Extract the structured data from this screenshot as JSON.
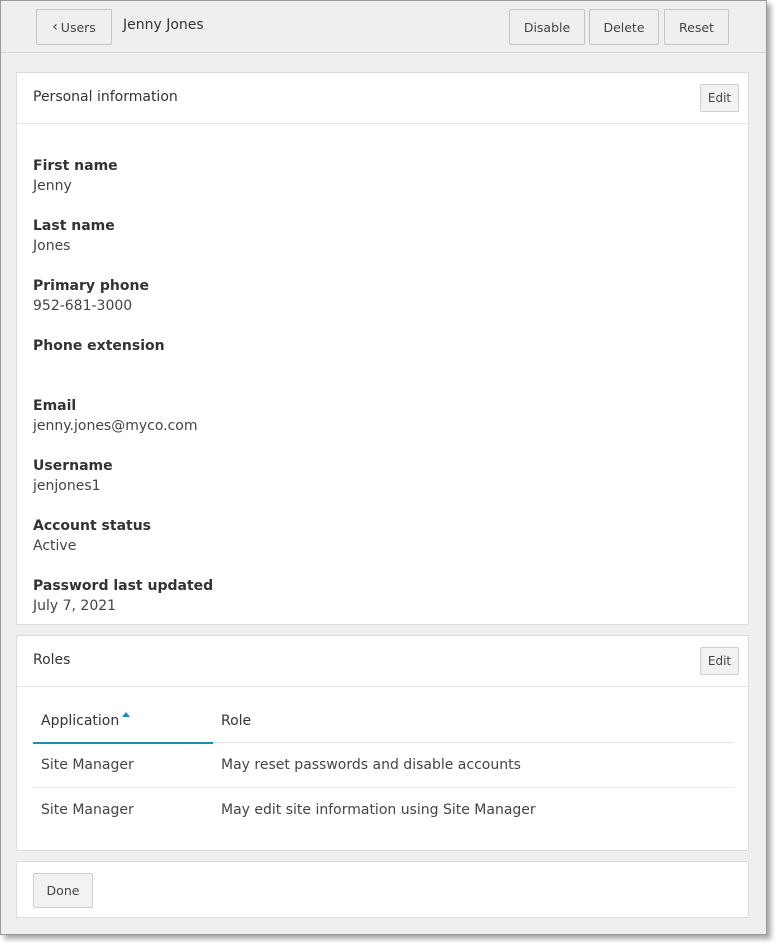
{
  "topbar": {
    "back_label": "Users",
    "title": "Jenny Jones",
    "disable_label": "Disable",
    "delete_label": "Delete",
    "reset_label": "Reset"
  },
  "personal": {
    "title": "Personal information",
    "edit_label": "Edit",
    "fields": [
      {
        "label": "First name",
        "value": "Jenny"
      },
      {
        "label": "Last name",
        "value": "Jones"
      },
      {
        "label": "Primary phone",
        "value": "952-681-3000"
      },
      {
        "label": "Phone extension",
        "value": ""
      },
      {
        "label": "Email",
        "value": "jenny.jones@myco.com"
      },
      {
        "label": "Username",
        "value": "jenjones1"
      },
      {
        "label": "Account status",
        "value": "Active"
      },
      {
        "label": "Password last updated",
        "value": "July 7, 2021"
      }
    ]
  },
  "roles": {
    "title": "Roles",
    "edit_label": "Edit",
    "columns": [
      "Application",
      "Role"
    ],
    "rows": [
      [
        "Site Manager",
        "May reset passwords and disable accounts"
      ],
      [
        "Site Manager",
        "May edit site information using Site Manager"
      ]
    ]
  },
  "footer": {
    "done_label": "Done"
  },
  "colors": {
    "accent": "#1a8cb8",
    "background": "#efefef"
  }
}
